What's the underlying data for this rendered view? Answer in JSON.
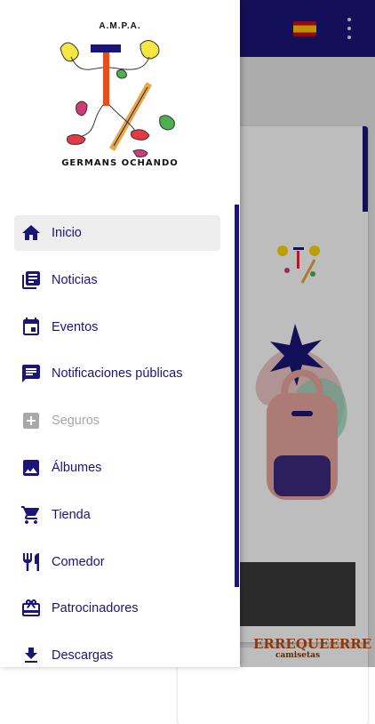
{
  "drawer": {
    "logo": {
      "top_text": "A.M.P.A.",
      "bottom_text": "GERMANS OCHANDO"
    },
    "nav_items": [
      {
        "label": "Inicio",
        "icon": "home-icon",
        "active": true
      },
      {
        "label": "Noticias",
        "icon": "news-icon"
      },
      {
        "label": "Eventos",
        "icon": "calendar-icon"
      },
      {
        "label": "Notificaciones públicas",
        "icon": "message-icon"
      },
      {
        "label": "Seguros",
        "icon": "plus-box-icon",
        "disabled": true
      },
      {
        "label": "Álbumes",
        "icon": "image-icon"
      },
      {
        "label": "Tienda",
        "icon": "cart-icon"
      },
      {
        "label": "Comedor",
        "icon": "restaurant-icon"
      },
      {
        "label": "Patrocinadores",
        "icon": "gift-icon"
      },
      {
        "label": "Descargas",
        "icon": "download-icon"
      }
    ]
  },
  "background": {
    "language_flag": "spain-flag",
    "sponsor_banner": {
      "name": "ERREQUEERRE",
      "tagline": "camisetas"
    }
  },
  "colors": {
    "primary": "#1b1579",
    "active_item_bg": "#eeeeee",
    "disabled_text": "#a8a8a8"
  }
}
